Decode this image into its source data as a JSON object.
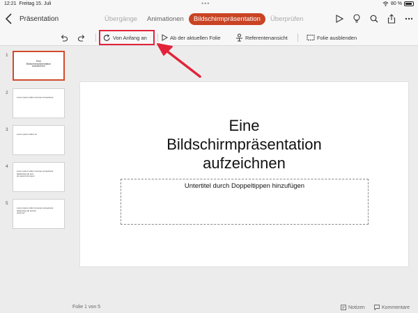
{
  "status_bar": {
    "time": "12:21",
    "date": "Freitag 15. Juli",
    "battery": "80 %",
    "wifi_icon": "wifi-icon"
  },
  "header": {
    "doc_title": "Präsentation",
    "tabs": [
      {
        "label": "Übergänge",
        "state": "faded"
      },
      {
        "label": "Animationen",
        "state": "normal"
      },
      {
        "label": "Bildschirmpräsentation",
        "state": "active"
      },
      {
        "label": "Überprüfen",
        "state": "faded"
      }
    ]
  },
  "ribbon": {
    "undo_icon": "undo-icon",
    "redo_icon": "redo-icon",
    "from_beginning": "Von Anfang an",
    "from_current": "Ab der aktuellen Folie",
    "presenter_view": "Referentenansicht",
    "hide_slide": "Folie ausblenden"
  },
  "thumbnails": [
    {
      "num": "1",
      "lines": [
        "Eine",
        "Bildschirmpräsentation",
        "aufzeichnen"
      ],
      "selected": true
    },
    {
      "num": "2",
      "lines": [
        "Lorem ipsum dolor sit amet consectetur"
      ],
      "selected": false
    },
    {
      "num": "3",
      "lines": [
        "Lorem ipsum dolor sit"
      ],
      "selected": false
    },
    {
      "num": "4",
      "lines": [
        "Lorem ipsum dolor sit amet consectetur adipiscing elit sed",
        "do eiusmod tempor"
      ],
      "selected": false
    },
    {
      "num": "5",
      "lines": [
        "Lorem ipsum dolor sit amet consectetur adipiscing elit sed do",
        "eiusmod"
      ],
      "selected": false
    }
  ],
  "slide": {
    "title_lines": [
      "Eine",
      "Bildschirmpräsentation",
      "aufzeichnen"
    ],
    "subtitle_placeholder": "Untertitel durch Doppeltippen hinzufügen"
  },
  "footer": {
    "slide_count": "Folie 1 von 5",
    "notes": "Notizen",
    "comments": "Kommentare"
  },
  "colors": {
    "accent": "#c94424",
    "annotation": "#e3223a"
  }
}
